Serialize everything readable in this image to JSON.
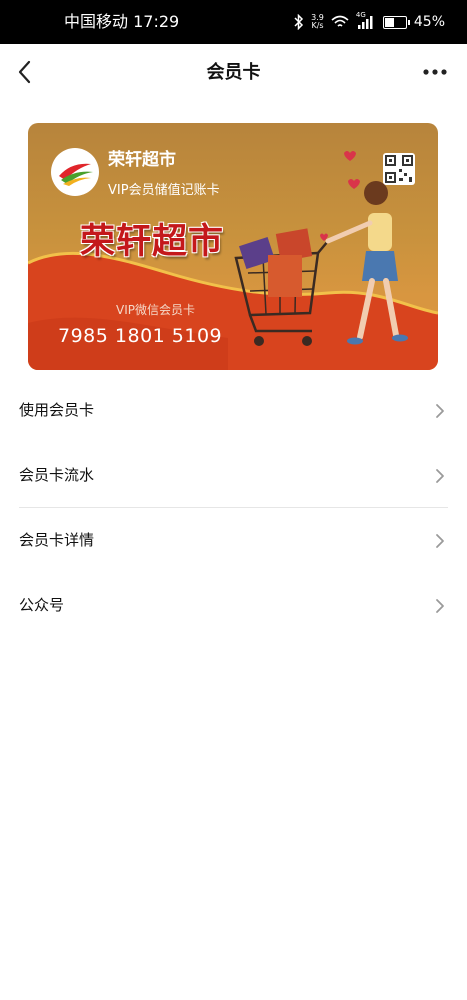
{
  "status_bar": {
    "carrier_time": "中国移动 17:29",
    "speed_value": "3.9",
    "speed_unit": "K/s",
    "network": "4G",
    "battery": "45%"
  },
  "header": {
    "title": "会员卡",
    "back_icon": "chevron-left-icon",
    "more_icon": "more-dots-icon"
  },
  "card": {
    "store_name": "荣轩超市",
    "logo_text": "荣轩超市",
    "card_type": "VIP会员储值记账卡",
    "banner_name": "荣轩超市",
    "wechat_label": "VIP微信会员卡",
    "card_number": "7985 1801 5109",
    "colors": {
      "gold": "#c8923d",
      "red": "#d8441e",
      "title_red": "#c4181b"
    }
  },
  "menu": {
    "items": [
      {
        "label": "使用会员卡"
      },
      {
        "label": "会员卡流水"
      },
      {
        "label": "会员卡详情"
      },
      {
        "label": "公众号"
      }
    ]
  }
}
